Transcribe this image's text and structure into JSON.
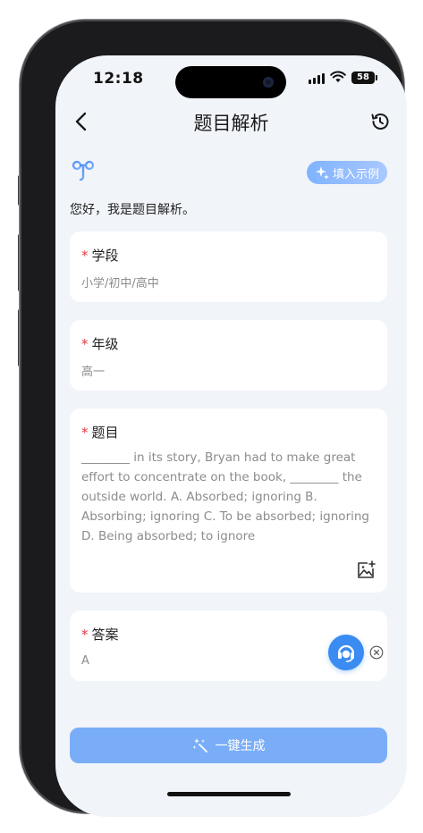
{
  "status_bar": {
    "time": "12:18",
    "battery": "58"
  },
  "header": {
    "title": "题目解析",
    "back_icon": "chevron-left-icon",
    "history_icon": "history-icon"
  },
  "assistant": {
    "example_button": "填入示例",
    "greeting": "您好，我是题目解析。"
  },
  "form": {
    "required_mark": "*",
    "stage": {
      "label": "学段",
      "value": "小学/初中/高中"
    },
    "grade": {
      "label": "年级",
      "value": "高一"
    },
    "question": {
      "label": "题目",
      "value": "________ in its story, Bryan had to make great effort to concentrate on the book, ________ the outside world.          A. Absorbed; ignoring B. Absorbing; ignoring C. To be absorbed; ignoring D. Being absorbed; to ignore"
    },
    "answer": {
      "label": "答案",
      "value": "A"
    }
  },
  "actions": {
    "generate_button": "一键生成"
  },
  "colors": {
    "accent": "#7aadf8",
    "support": "#3a8bf2",
    "required": "#e0383e"
  }
}
